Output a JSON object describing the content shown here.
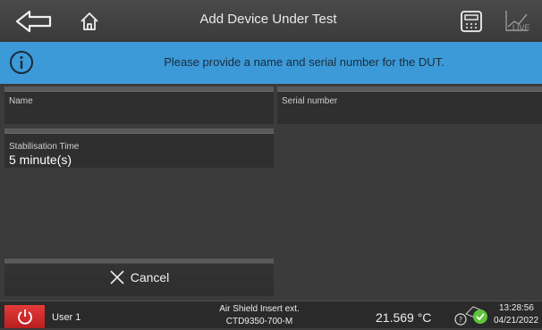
{
  "header": {
    "title": "Add Device Under Test",
    "back_icon": "back-arrow-icon",
    "home_icon": "home-icon",
    "calculator_icon": "calculator-icon",
    "live_icon": "live-chart-icon",
    "live_label": "LIVE"
  },
  "info": {
    "icon": "info-icon",
    "message": "Please provide a name and serial number for the DUT."
  },
  "form": {
    "name_label": "Name",
    "name_value": "",
    "serial_label": "Serial number",
    "serial_value": "",
    "stab_label": "Stabilisation Time",
    "stab_value": "5 minute(s)"
  },
  "actions": {
    "cancel_label": "Cancel"
  },
  "status": {
    "user": "User 1",
    "device_line1": "Air Shield Insert ext.",
    "device_line2": "CTD9350-700-M",
    "temperature": "21.569 °C",
    "time": "13:28:56",
    "date": "04/21/2022"
  },
  "colors": {
    "info_bar": "#3c9ad8",
    "power_button": "#d32f2f",
    "status_ok": "#5fc43a"
  }
}
